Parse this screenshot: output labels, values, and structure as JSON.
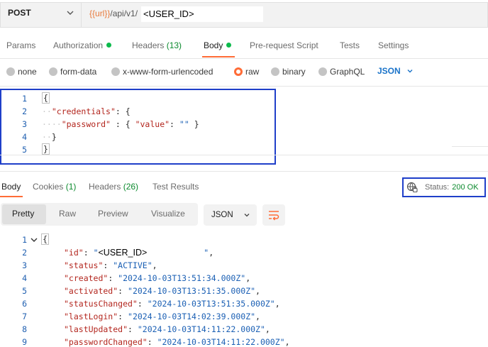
{
  "request": {
    "method": "POST",
    "url_var": "{{url}}",
    "url_path": "/api/v1/",
    "url_user_id": "<USER_ID>"
  },
  "request_tabs": {
    "params": "Params",
    "authorization": "Authorization",
    "headers": "Headers",
    "headers_count": "(13)",
    "body": "Body",
    "prerequest": "Pre-request Script",
    "tests": "Tests",
    "settings": "Settings"
  },
  "body_types": {
    "none": "none",
    "form_data": "form-data",
    "urlencoded": "x-www-form-urlencoded",
    "raw": "raw",
    "binary": "binary",
    "graphql": "GraphQL",
    "language": "JSON"
  },
  "request_body": {
    "line_numbers": [
      "1",
      "2",
      "3",
      "4",
      "5"
    ],
    "open_brace": "{",
    "credentials_key": "\"credentials\"",
    "password_key": "\"password\"",
    "value_key": "\"value\"",
    "value_str": "\"\"",
    "close_brace": "}"
  },
  "response_tabs": {
    "body": "Body",
    "cookies": "Cookies",
    "cookies_count": "(1)",
    "headers": "Headers",
    "headers_count": "(26)",
    "test_results": "Test Results"
  },
  "status": {
    "label": "Status:",
    "value": "200 OK"
  },
  "view_modes": {
    "pretty": "Pretty",
    "raw": "Raw",
    "preview": "Preview",
    "visualize": "Visualize",
    "format": "JSON"
  },
  "response_body": {
    "line_numbers": [
      "1",
      "2",
      "3",
      "4",
      "5",
      "6",
      "7",
      "8",
      "9"
    ],
    "open_brace": "{",
    "id_key": "\"id\"",
    "id_value_quote": "\"",
    "id_value_masked": "<USER_ID>",
    "fields": [
      {
        "key": "\"status\"",
        "value": "\"ACTIVE\""
      },
      {
        "key": "\"created\"",
        "value": "\"2024-10-03T13:51:34.000Z\""
      },
      {
        "key": "\"activated\"",
        "value": "\"2024-10-03T13:51:35.000Z\""
      },
      {
        "key": "\"statusChanged\"",
        "value": "\"2024-10-03T13:51:35.000Z\""
      },
      {
        "key": "\"lastLogin\"",
        "value": "\"2024-10-03T14:02:39.000Z\""
      },
      {
        "key": "\"lastUpdated\"",
        "value": "\"2024-10-03T14:11:22.000Z\""
      },
      {
        "key": "\"passwordChanged\"",
        "value": "\"2024-10-03T14:11:22.000Z\""
      }
    ]
  }
}
